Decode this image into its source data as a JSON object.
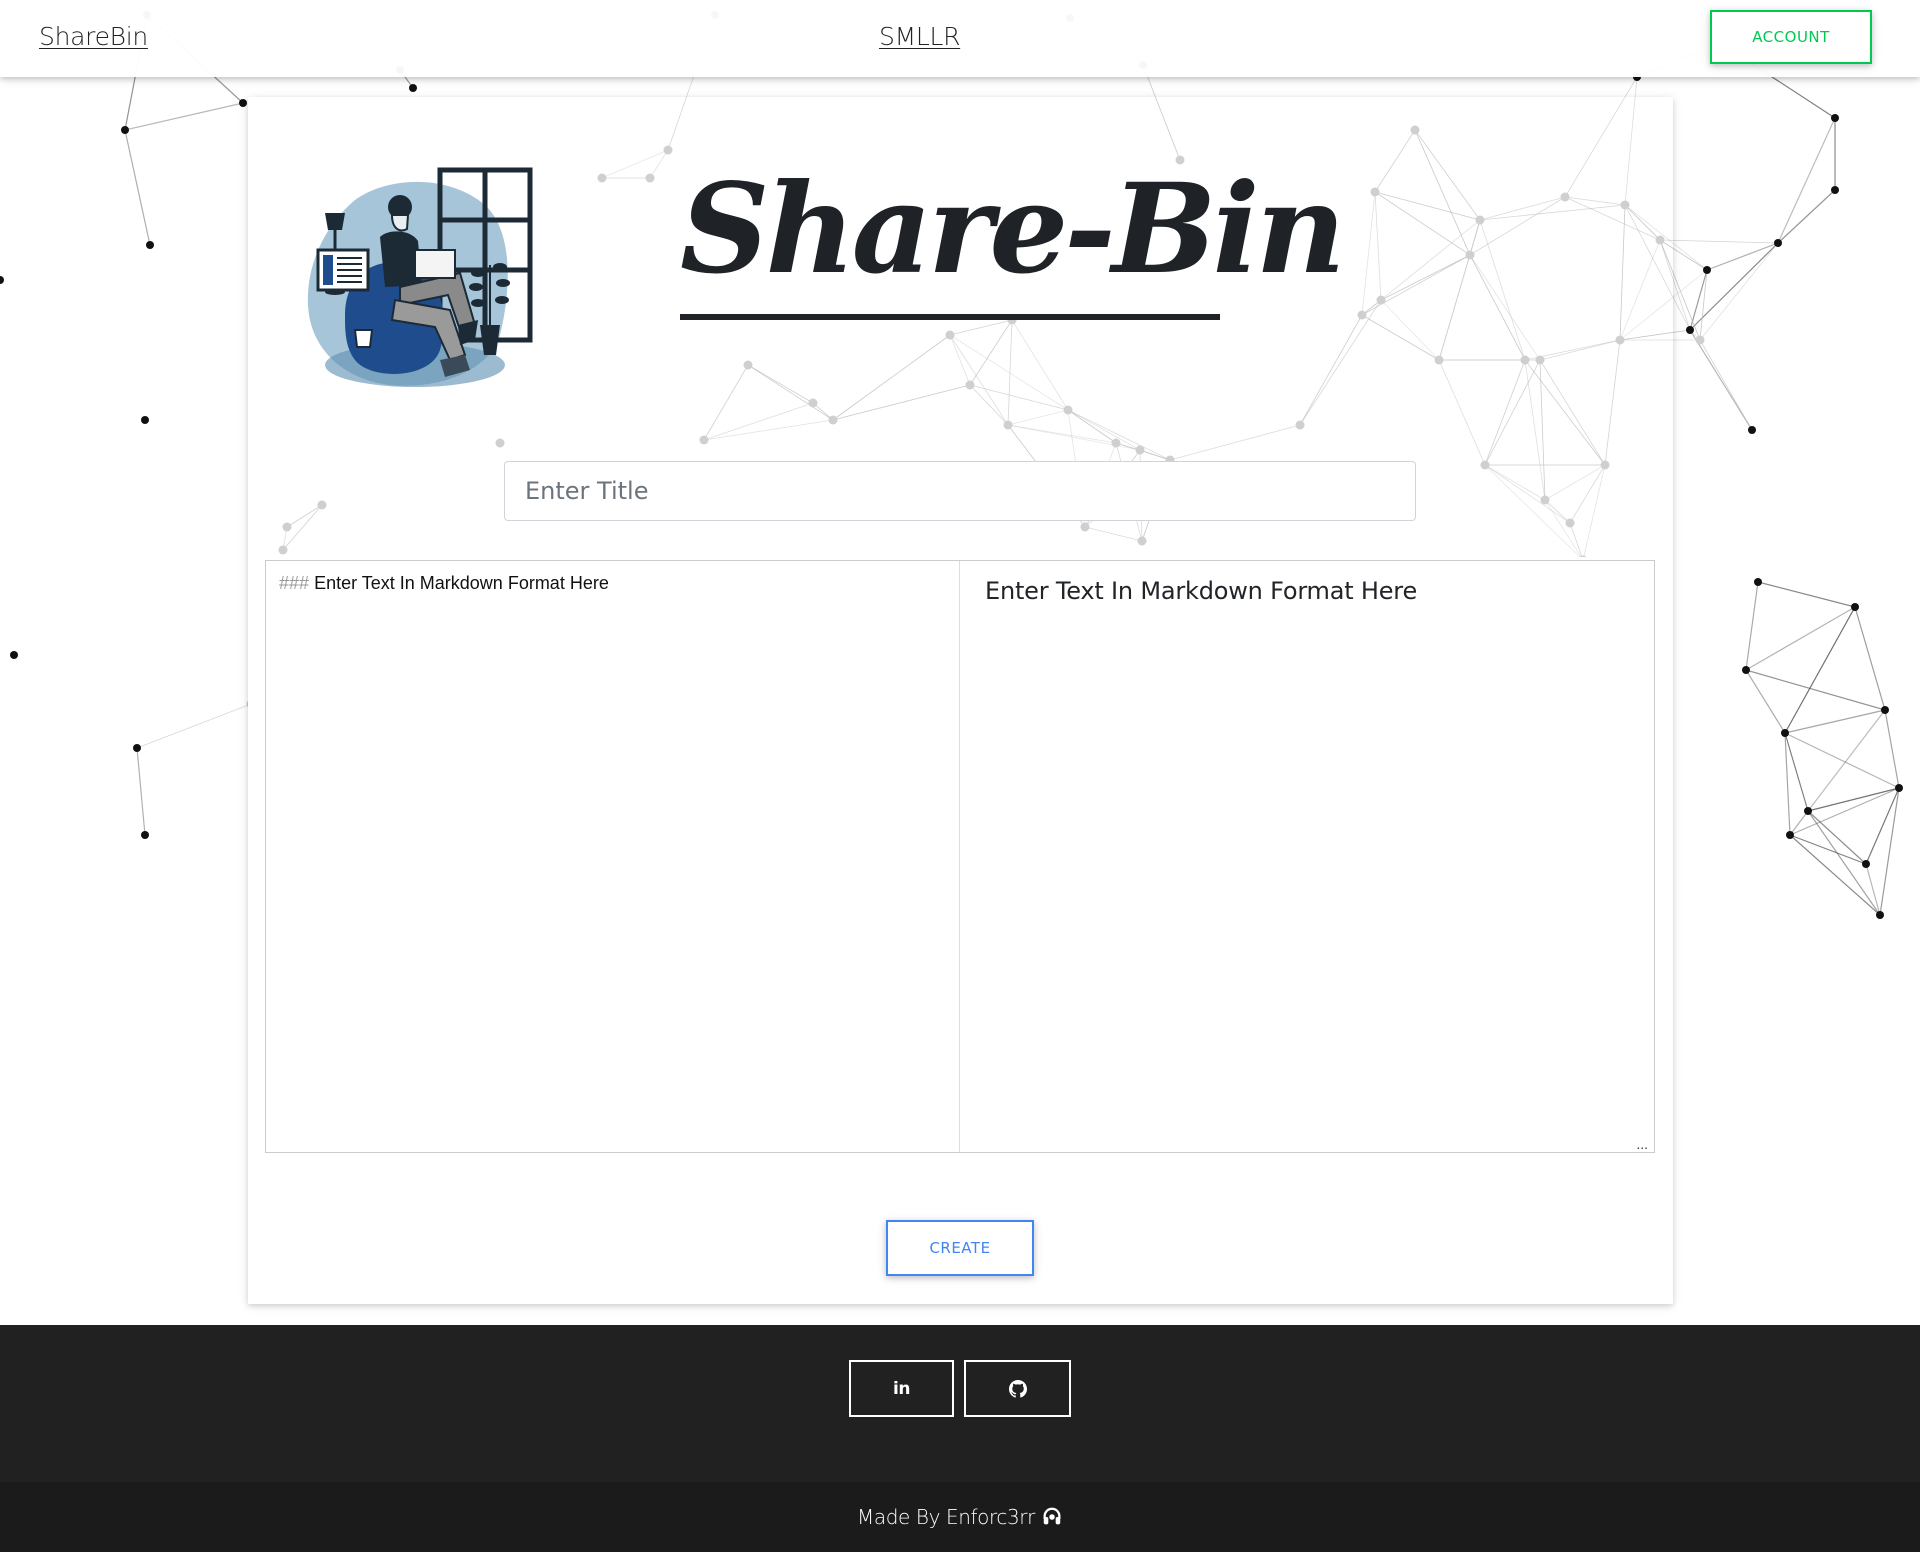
{
  "nav": {
    "brand": "ShareBin",
    "center_link": "SMLLR",
    "account_label": "ACCOUNT"
  },
  "hero": {
    "title": "Share-Bin",
    "illustration_icon": "person-with-laptop-illustration"
  },
  "form": {
    "title_placeholder": "Enter Title",
    "editor_hash": "###",
    "editor_text": "Enter Text In Markdown Format Here",
    "preview_heading": "Enter Text In Markdown Format Here",
    "resize_handle": "...",
    "create_label": "CREATE"
  },
  "footer": {
    "social": [
      {
        "icon": "linkedin-icon",
        "glyph": "in"
      },
      {
        "icon": "github-icon"
      }
    ],
    "credit_text": "Made By Enforc3rr",
    "credit_icon": "headset-icon"
  },
  "colors": {
    "account_accent": "#00c851",
    "create_accent": "#4285f4",
    "footer_bg": "#212121",
    "copyright_bg": "#1b1b1b"
  }
}
